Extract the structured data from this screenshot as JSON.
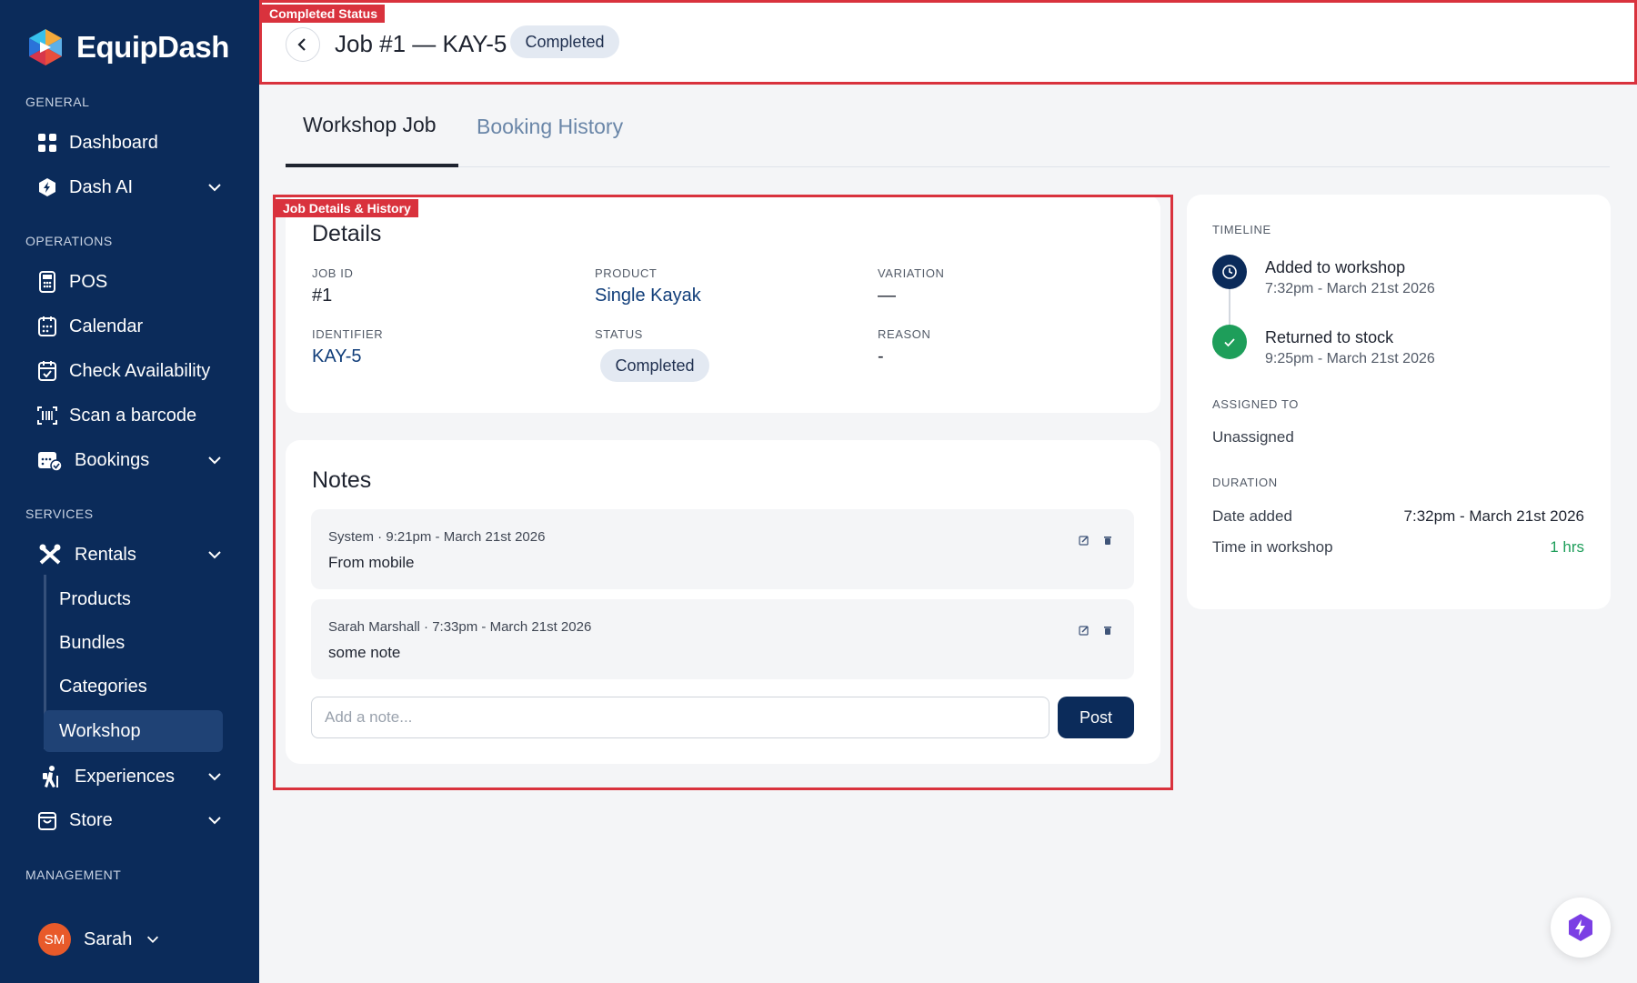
{
  "app": {
    "name": "EquipDash"
  },
  "sidebar": {
    "sections": {
      "general": "GENERAL",
      "operations": "OPERATIONS",
      "services": "SERVICES",
      "management": "MANAGEMENT"
    },
    "items": {
      "dashboard": "Dashboard",
      "dash_ai": "Dash AI",
      "pos": "POS",
      "calendar": "Calendar",
      "check_availability": "Check Availability",
      "scan_barcode": "Scan a barcode",
      "bookings": "Bookings",
      "rentals": "Rentals",
      "experiences": "Experiences",
      "store": "Store"
    },
    "rentals_sub": [
      "Products",
      "Bundles",
      "Categories",
      "Workshop"
    ],
    "user": {
      "initials": "SM",
      "name": "Sarah"
    }
  },
  "annotations": {
    "header": "Completed Status",
    "details": "Job Details & History"
  },
  "header": {
    "title": "Job #1 — KAY-5",
    "status": "Completed"
  },
  "tabs": [
    "Workshop Job",
    "Booking History"
  ],
  "details": {
    "title": "Details",
    "job_id_label": "JOB ID",
    "job_id": "#1",
    "product_label": "PRODUCT",
    "product": "Single Kayak",
    "variation_label": "VARIATION",
    "variation": "—",
    "identifier_label": "IDENTIFIER",
    "identifier": "KAY-5",
    "status_label": "STATUS",
    "status": "Completed",
    "reason_label": "REASON",
    "reason": "-"
  },
  "notes": {
    "title": "Notes",
    "items": [
      {
        "meta": "System · 9:21pm - March 21st 2026",
        "text": "From mobile"
      },
      {
        "meta": "Sarah Marshall · 7:33pm - March 21st 2026",
        "text": "some note"
      }
    ],
    "placeholder": "Add a note...",
    "post_label": "Post"
  },
  "timeline": {
    "label": "TIMELINE",
    "events": [
      {
        "title": "Added to workshop",
        "time": "7:32pm - March 21st 2026"
      },
      {
        "title": "Returned to stock",
        "time": "9:25pm - March 21st 2026"
      }
    ],
    "assigned_label": "ASSIGNED TO",
    "assigned": "Unassigned",
    "duration_label": "DURATION",
    "date_added_label": "Date added",
    "date_added": "7:32pm - March 21st 2026",
    "time_label": "Time in workshop",
    "time_in_workshop": "1 hrs"
  },
  "colors": {
    "sidebar": "#0b2b5a",
    "accent_red": "#d9323d",
    "success": "#1e9e5a"
  }
}
